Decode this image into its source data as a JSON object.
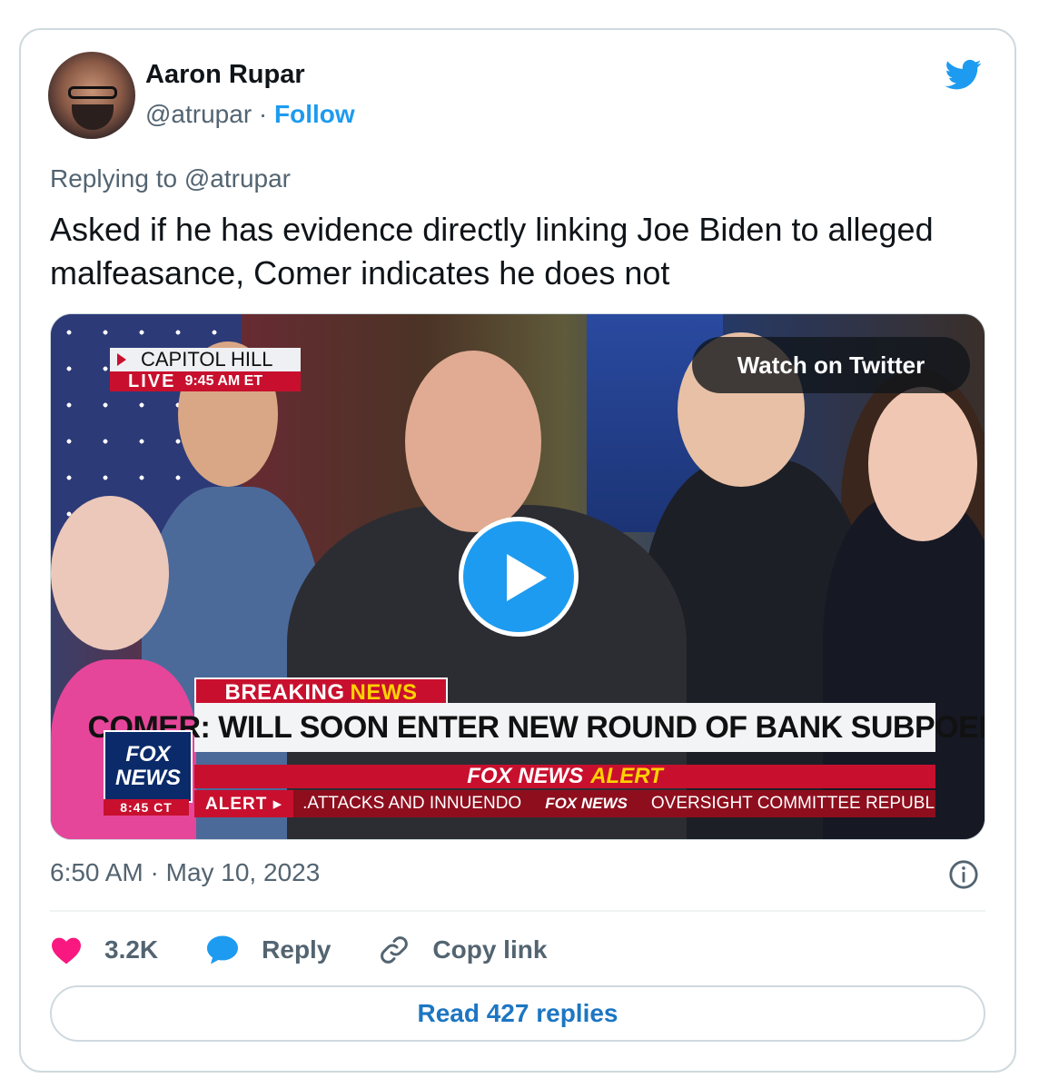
{
  "author": {
    "name": "Aaron Rupar",
    "handle": "@atrupar",
    "separator": "·",
    "follow_label": "Follow"
  },
  "icons": {
    "brand": "twitter-bird-icon",
    "info": "info-icon",
    "like": "heart-icon",
    "reply": "speech-bubble-icon",
    "copy": "link-icon",
    "play": "play-icon"
  },
  "colors": {
    "accent": "#1d9bf0",
    "like": "#f91880",
    "muted": "#536471",
    "text": "#0f1419"
  },
  "tweet": {
    "replying_to": "Replying to @atrupar",
    "text": "Asked if he has evidence directly linking Joe Biden to alleged malfeasance, Comer indicates he does not",
    "timestamp": "6:50 AM · May 10, 2023"
  },
  "media": {
    "watch_label": "Watch on Twitter",
    "chyron": {
      "location": "CAPITOL HILL",
      "live": "LIVE",
      "live_time": "9:45 AM ET",
      "breaking": "BREAKING",
      "news": "NEWS",
      "headline": "COMER: WILL SOON ENTER NEW ROUND OF BANK SUBPOENAS",
      "alert_brand": "FOX NEWS",
      "alert_word": "ALERT",
      "ticker_tag": "ALERT ▸",
      "ticker_1": ".ATTACKS AND INNUENDO",
      "ticker_brand": "FOX NEWS",
      "ticker_2": "OVERSIGHT COMMITTEE REPUBLICAN",
      "logo_line1": "FOX",
      "logo_line2": "NEWS",
      "logo_time": "8:45 CT"
    }
  },
  "actions": {
    "likes": "3.2K",
    "reply_label": "Reply",
    "copy_label": "Copy link"
  },
  "read_replies": "Read 427 replies"
}
